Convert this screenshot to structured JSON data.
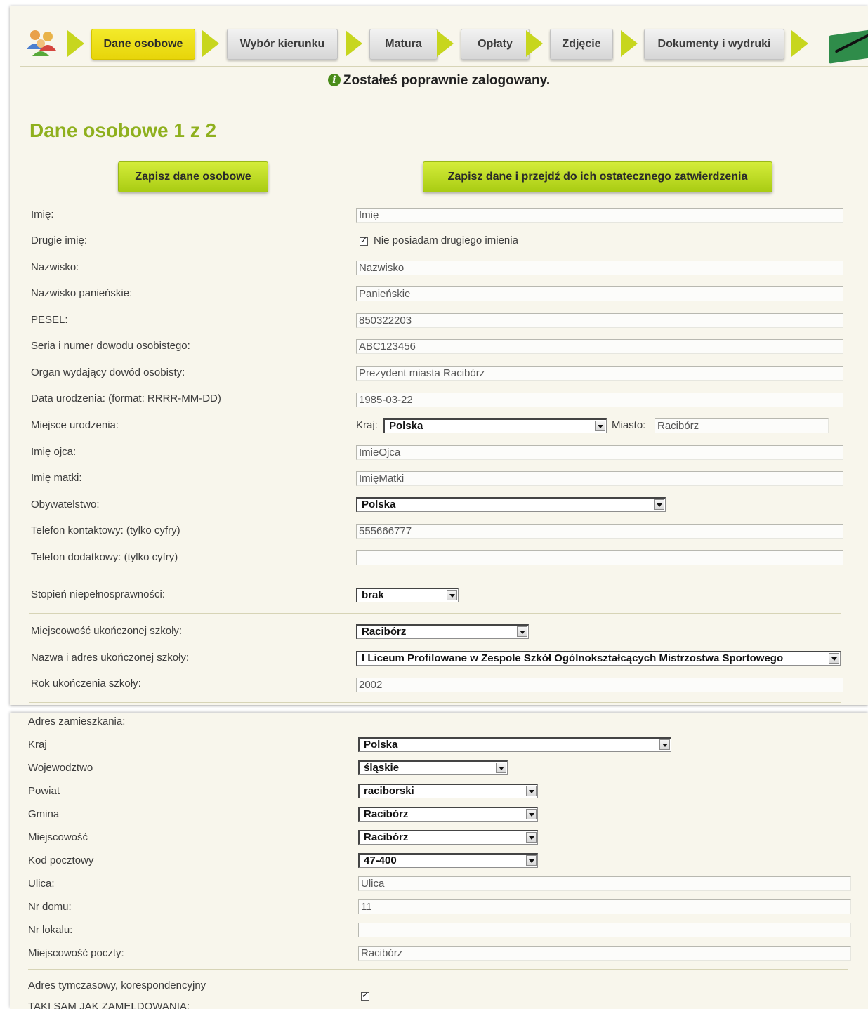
{
  "nav": {
    "steps": [
      "Dane osobowe",
      "Wybór kierunku",
      "Matura",
      "Opłaty",
      "Zdjęcie",
      "Dokumenty i wydruki"
    ],
    "active": "Dane osobowe",
    "accent": "#c7d61e"
  },
  "info": {
    "message": "Zostałeś poprawnie zalogowany."
  },
  "page": {
    "title": "Dane osobowe 1 z 2",
    "btn_save": "Zapisz dane osobowe",
    "btn_save_confirm": "Zapisz dane i przejdź do ich ostatecznego zatwierdzenia"
  },
  "personal": {
    "imie_label": "Imię:",
    "imie_value": "Imię",
    "drugie_label": "Drugie imię:",
    "drugie_check": "Nie posiadam drugiego imienia",
    "nazwisko_label": "Nazwisko:",
    "nazwisko_value": "Nazwisko",
    "panienskie_label": "Nazwisko panieńskie:",
    "panienskie_value": "Panieńskie",
    "pesel_label": "PESEL:",
    "pesel_value": "850322203",
    "dowod_label": "Seria i numer dowodu osobistego:",
    "dowod_value": "ABC123456",
    "organ_label": "Organ wydający dowód osobisty:",
    "organ_value": "Prezydent miasta Racibórz",
    "data_label": "Data urodzenia: (format: RRRR-MM-DD)",
    "data_value": "1985-03-22",
    "miejsce_label": "Miejsce urodzenia:",
    "kraj_label": "Kraj:",
    "kraj_value": "Polska",
    "miasto_label": "Miasto:",
    "miasto_value": "Racibórz",
    "ojciec_label": "Imię ojca:",
    "ojciec_value": "ImieOjca",
    "matka_label": "Imię matki:",
    "matka_value": "ImięMatki",
    "obyw_label": "Obywatelstwo:",
    "obyw_value": "Polska",
    "tel_label": "Telefon kontaktowy: (tylko cyfry)",
    "tel_value": "555666777",
    "tel2_label": "Telefon dodatkowy: (tylko cyfry)",
    "tel2_value": "",
    "niepeln_label": "Stopień niepełnosprawności:",
    "niepeln_value": "brak",
    "szk_miejsc_label": "Miejscowość ukończonej szkoły:",
    "szk_miejsc_value": "Racibórz",
    "szk_nazwa_label": "Nazwa i adres ukończonej szkoły:",
    "szk_nazwa_value": "I Liceum Profilowane w Zespole Szkół Ogólnokształcących Mistrzostwa Sportowego",
    "szk_rok_label": "Rok ukończenia szkoły:",
    "szk_rok_value": "2002"
  },
  "address": {
    "header": "Adres zamieszkania:",
    "kraj_label": "Kraj",
    "kraj_value": "Polska",
    "woj_label": "Wojewodztwo",
    "woj_value": "śląskie",
    "powiat_label": "Powiat",
    "powiat_value": "raciborski",
    "gmina_label": "Gmina",
    "gmina_value": "Racibórz",
    "miejsc_label": "Miejscowość",
    "miejsc_value": "Racibórz",
    "kod_label": "Kod pocztowy",
    "kod_value": "47-400",
    "ulica_label": "Ulica:",
    "ulica_value": "Ulica",
    "dom_label": "Nr domu:",
    "dom_value": "11",
    "lokal_label": "Nr lokalu:",
    "lokal_value": "",
    "poczta_label": "Miejscowość poczty:",
    "poczta_value": "Racibórz",
    "tymczasowy_label": "Adres tymczasowy, korespondencyjny",
    "taki_sam_label": "TAKI SAM JAK ZAMELDOWANIA:"
  }
}
